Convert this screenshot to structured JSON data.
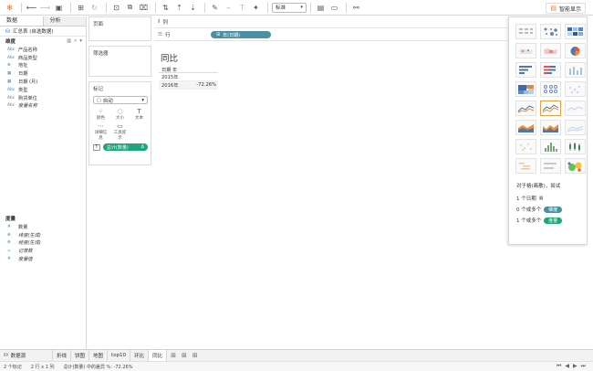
{
  "toolbar": {
    "fit_select": "标准",
    "smart_label": "智能显示"
  },
  "left": {
    "tab_data": "数据",
    "tab_analysis": "分析",
    "datasource": "汇总表 (自选数据)",
    "dims_header": "维度",
    "dimensions": [
      {
        "type": "Abc",
        "name": "产品名称",
        "italic": false
      },
      {
        "type": "Abc",
        "name": "商品类型",
        "italic": false
      },
      {
        "type": "⊕",
        "name": "地址",
        "italic": false
      },
      {
        "type": "▦",
        "name": "日期",
        "italic": false
      },
      {
        "type": "▦",
        "name": "日期 (月)",
        "italic": false
      },
      {
        "type": "Abc",
        "name": "类型",
        "italic": false
      },
      {
        "type": "Abc",
        "name": "购货单位",
        "italic": false
      },
      {
        "type": "Abc",
        "name": "度量名称",
        "italic": true
      }
    ],
    "measures_header": "度量",
    "measures": [
      {
        "type": "#",
        "name": "数量",
        "italic": false
      },
      {
        "type": "⊕",
        "name": "纬度(生成)",
        "italic": true
      },
      {
        "type": "⊕",
        "name": "经度(生成)",
        "italic": true
      },
      {
        "type": "=",
        "name": "记录数",
        "italic": true
      },
      {
        "type": "#",
        "name": "度量值",
        "italic": true
      }
    ]
  },
  "shelves": {
    "pages": "页面",
    "filters": "筛选器",
    "marks": "标记",
    "mark_type": "自动",
    "mark_buttons": [
      {
        "icon": "⁘",
        "label": "颜色"
      },
      {
        "icon": "◌",
        "label": "大小"
      },
      {
        "icon": "T",
        "label": "文本"
      },
      {
        "icon": "⋯",
        "label": "详细信息"
      },
      {
        "icon": "▭",
        "label": "工具提示"
      }
    ],
    "text_pill": "总计(数量)",
    "text_pill_delta": "Δ",
    "columns": "列",
    "rows": "行",
    "rows_pill": "年(日期)"
  },
  "view": {
    "title": "同比",
    "header": "日期 年",
    "rows": [
      {
        "year": "2015年",
        "value": ""
      },
      {
        "year": "2016年",
        "value": "-72.26%"
      }
    ]
  },
  "showme": {
    "hint_title": "对于格(离散)，尝试",
    "req1": "1 个日期",
    "req2_prefix": "0 个或多个",
    "req2_pill": "维度",
    "req3_prefix": "1 个或多个",
    "req3_pill": "度量"
  },
  "sheets": {
    "datasource": "数据源",
    "tabs": [
      "折线",
      "饼图",
      "地图",
      "top10",
      "环比",
      "同比"
    ],
    "active": "同比"
  },
  "status": {
    "marks": "2 个标记",
    "dims": "2 行 x 1 列",
    "agg": "总计(数量) 中的差异 %: -72.26%"
  }
}
